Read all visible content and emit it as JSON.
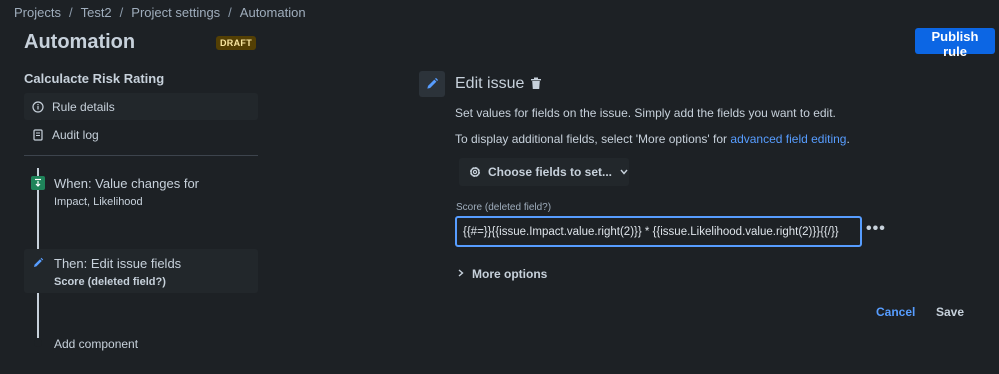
{
  "breadcrumb": [
    "Projects",
    "Test2",
    "Project settings",
    "Automation"
  ],
  "page": {
    "title": "Automation",
    "badge": "DRAFT",
    "publish_label": "Publish rule"
  },
  "sidebar": {
    "rule_name": "Calculacte Risk Rating",
    "items": [
      {
        "label": "Rule details",
        "icon": "info-icon"
      },
      {
        "label": "Audit log",
        "icon": "document-icon"
      }
    ],
    "steps": [
      {
        "title": "When: Value changes for",
        "subtitle": "Impact, Likelihood",
        "icon": "trigger-icon"
      },
      {
        "title": "Then: Edit issue fields",
        "subtitle": "Score (deleted field?)",
        "icon": "pencil-icon"
      }
    ],
    "add_component": "Add component"
  },
  "main": {
    "title": "Edit issue",
    "description": "Set values for fields on the issue. Simply add the fields you want to edit.",
    "more_info_prefix": "To display additional fields, select 'More options' for ",
    "more_info_link": "advanced field editing",
    "more_info_suffix": ".",
    "choose_fields_label": "Choose fields to set...",
    "field": {
      "label": "Score (deleted field?)",
      "value": "{{#=}}{{issue.Impact.value.right(2)}} * {{issue.Likelihood.value.right(2)}}{{/}}"
    },
    "more_dots": "•••",
    "more_options_label": "More options",
    "cancel_label": "Cancel",
    "save_label": "Save"
  },
  "colors": {
    "accent": "#0c66e4",
    "link": "#579dff",
    "background": "#1d2125",
    "trigger": "#1f845a"
  }
}
